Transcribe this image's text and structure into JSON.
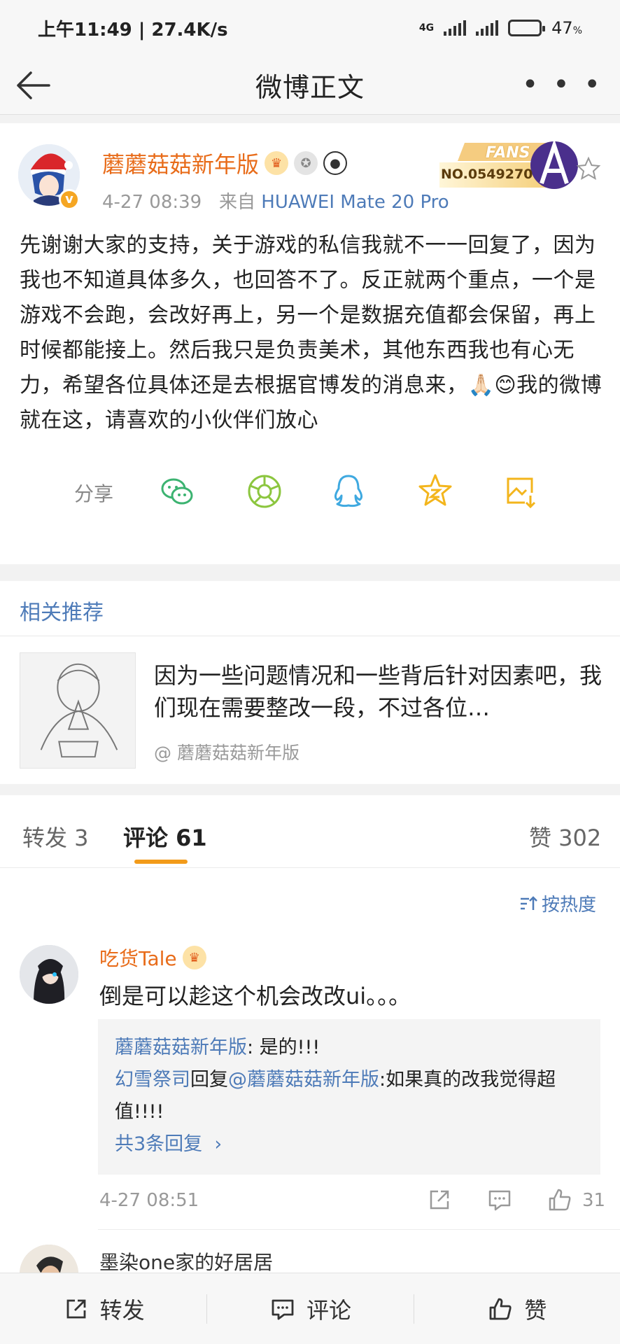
{
  "status_bar": {
    "time_speed": "上午11:49 | 27.4K/s",
    "network": "4G",
    "battery_percent": "47",
    "battery_unit": "%",
    "battery_level": 0.47
  },
  "header": {
    "title": "微博正文",
    "more_label": "• • •"
  },
  "post": {
    "author": "蘑蘑菇菇新年版",
    "verified_badge": "v",
    "fans_label": "FANS",
    "fans_no": "NO.0549270",
    "time": "4-27 08:39",
    "from_label": "来自",
    "device": "HUAWEI Mate 20 Pro",
    "text": "先谢谢大家的支持，关于游戏的私信我就不一一回复了，因为我也不知道具体多久，也回答不了。反正就两个重点，一个是游戏不会跑，会改好再上，另一个是数据充值都会保留，再上时候都能接上。然后我只是负责美术，其他东西我也有心无力，希望各位具体还是去根据官博发的消息来，🙏🏻😊我的微博就在这，请喜欢的小伙伴们放心",
    "share_label": "分享"
  },
  "related": {
    "title": "相关推荐",
    "text": "因为一些问题情况和一些背后针对因素吧，我们现在需要整改一段，不过各位…",
    "author": "@ 蘑蘑菇菇新年版"
  },
  "tabs": {
    "repost": "转发 3",
    "comment": "评论 61",
    "like": "赞 302"
  },
  "sort_label": "按热度",
  "comment": {
    "author": "吃货Tale",
    "text": "倒是可以趁这个机会改改ui。。。",
    "reply1_user": "蘑蘑菇菇新年版",
    "reply1_text": ": 是的!!!",
    "reply2_user": "幻雪祭司",
    "reply2_mid": "回复",
    "reply2_at": "@蘑蘑菇菇新年版",
    "reply2_text": ":如果真的改我觉得超值!!!!",
    "more_replies": "共3条回复",
    "time": "4-27 08:51",
    "like_count": "31"
  },
  "comment2": {
    "author": "墨染one家的好居居"
  },
  "bottom_bar": {
    "repost": "转发",
    "comment": "评论",
    "like": "赞"
  },
  "colors": {
    "accent_orange": "#e86c1a",
    "link_blue": "#4e7bb8",
    "tab_underline": "#f29b1a"
  },
  "icons": [
    "back-arrow-icon",
    "more-icon",
    "wechat-icon",
    "moments-icon",
    "qq-icon",
    "weibo-star-icon",
    "image-save-icon",
    "sort-icon",
    "repost-icon",
    "comment-icon",
    "like-icon",
    "star-icon"
  ]
}
